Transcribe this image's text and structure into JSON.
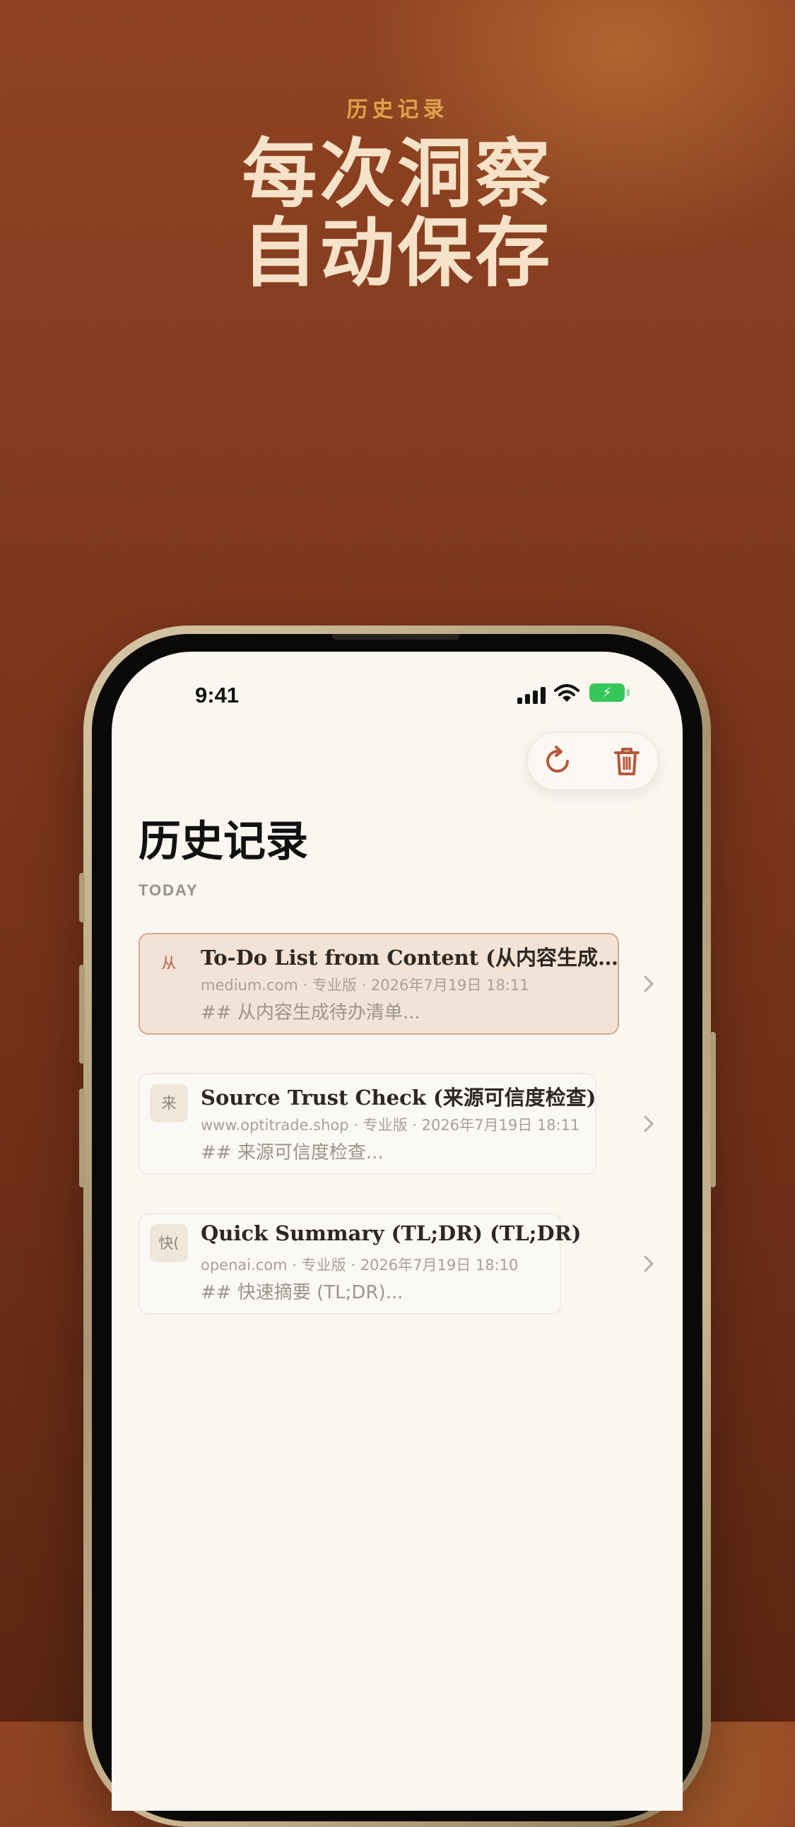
{
  "promo": {
    "eyebrow": "历史记录",
    "headline_line1": "每次洞察",
    "headline_line2": "自动保存"
  },
  "status_bar": {
    "time": "9:41"
  },
  "toolbar": {
    "refresh_icon": "refresh-icon",
    "delete_icon": "trash-icon"
  },
  "page": {
    "title": "历史记录",
    "section": "TODAY"
  },
  "history": [
    {
      "avatar": "从",
      "title": "To-Do List from Content (从内容生成…",
      "meta": "medium.com · 专业版 · 2026年7月19日 18:11",
      "preview": "## 从内容生成待办清单...",
      "selected": true
    },
    {
      "avatar": "来",
      "title": "Source Trust Check (来源可信度检查)",
      "meta": "www.optitrade.shop · 专业版 · 2026年7月19日 18:11",
      "preview": "## 来源可信度检查...",
      "selected": false
    },
    {
      "avatar": "快(",
      "title": "Quick Summary (TL;DR) (TL;DR)",
      "meta": "openai.com · 专业版 · 2026年7月19日 18:10",
      "preview": "## 快速摘要 (TL;DR)...",
      "selected": false
    }
  ],
  "colors": {
    "accent": "#b5583a",
    "battery": "#35c759",
    "selected_bg": "#f2e3d6"
  }
}
